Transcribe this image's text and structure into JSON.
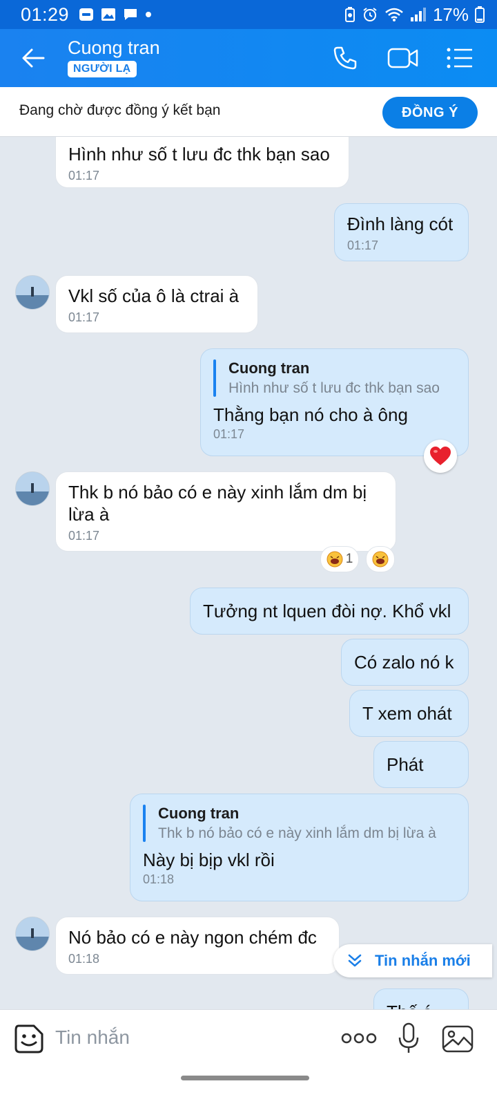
{
  "status_bar": {
    "time": "01:29",
    "battery": "17%"
  },
  "header": {
    "contact_name": "Cuong tran",
    "badge": "NGƯỜI LẠ"
  },
  "friend_request": {
    "text": "Đang chờ được đồng ý kết bạn",
    "accept_label": "ĐỒNG Ý"
  },
  "messages": [
    {
      "text": "Hình như số t lưu đc thk bạn sao",
      "time": "01:17"
    },
    {
      "text": "Đình làng cót",
      "time": "01:17"
    },
    {
      "text": "Vkl số của ô là ctrai à",
      "time": "01:17"
    },
    {
      "quote_name": "Cuong tran",
      "quote_text": "Hình như số t lưu đc thk bạn sao",
      "text": "Thằng bạn nó cho à ông",
      "time": "01:17"
    },
    {
      "text": "Thk b nó bảo có e này xinh lắm dm bị lừa à",
      "time": "01:17",
      "reaction_count": "1"
    },
    {
      "text": "Tưởng nt lquen đòi nợ. Khổ vkl"
    },
    {
      "text": "Có zalo nó k"
    },
    {
      "text": "T xem ohát"
    },
    {
      "text": "Phát"
    },
    {
      "quote_name": "Cuong tran",
      "quote_text": "Thk b nó bảo có e này xinh lắm dm bị lừa à",
      "text": "Này bị bịp vkl rồi",
      "time": "01:18"
    },
    {
      "text": "Nó bảo có e này ngon chém đc",
      "time": "01:18"
    },
    {
      "text": "Thế á"
    }
  ],
  "new_messages_label": "Tin nhắn mới",
  "input": {
    "placeholder": "Tin nhắn"
  },
  "colors": {
    "header": "#1a82f0",
    "outgoing_bubble": "#d5eafc",
    "incoming_bubble": "#ffffff",
    "chat_background": "#e2e8ef"
  }
}
